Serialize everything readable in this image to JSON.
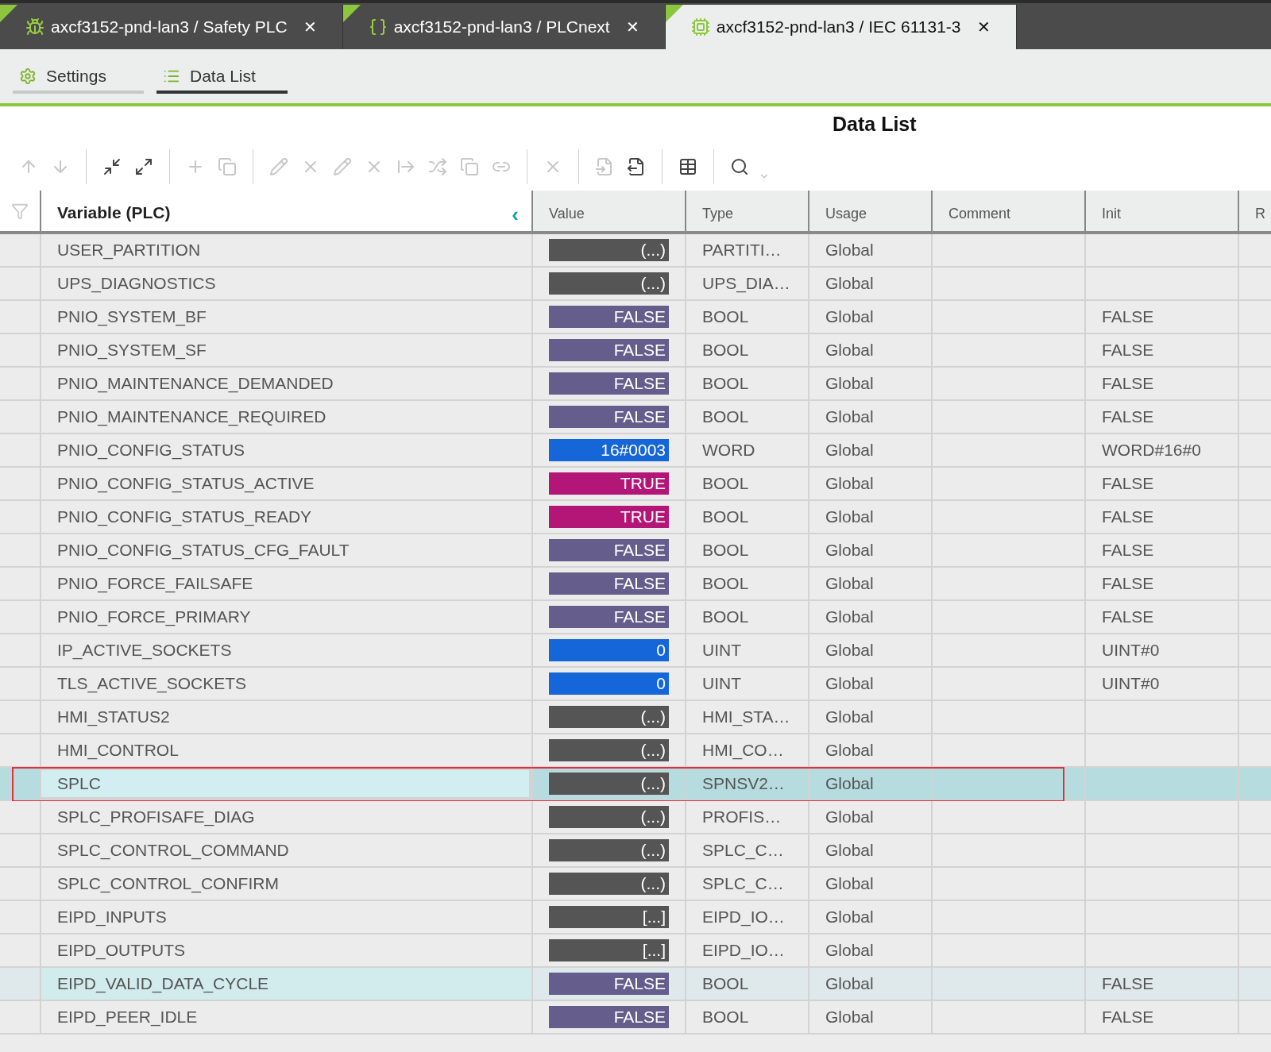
{
  "tabs": [
    {
      "label": "axcf3152-pnd-lan3 / Safety PLC",
      "selected": false,
      "kind": "safety"
    },
    {
      "label": "axcf3152-pnd-lan3 / PLCnext",
      "selected": false,
      "kind": "plcnext"
    },
    {
      "label": "axcf3152-pnd-lan3 / IEC 61131-3",
      "selected": true,
      "kind": "iec"
    }
  ],
  "close_glyph": "✕",
  "subtabs": [
    {
      "label": "Settings",
      "selected": false,
      "kind": "settings"
    },
    {
      "label": "Data List",
      "selected": true,
      "kind": "list"
    }
  ],
  "title": "Data List",
  "table": {
    "columns": [
      "Variable (PLC)",
      "Value",
      "Type",
      "Usage",
      "Comment",
      "Init",
      "R"
    ],
    "collapse_glyph": "‹",
    "rows": [
      {
        "variable": "USER_PARTITION",
        "value": "(...)",
        "kind": "complex",
        "type": "PARTITI…",
        "usage": "Global",
        "init": "",
        "selected": false,
        "hovered": false
      },
      {
        "variable": "UPS_DIAGNOSTICS",
        "value": "(...)",
        "kind": "complex",
        "type": "UPS_DIA…",
        "usage": "Global",
        "init": "",
        "selected": false,
        "hovered": false
      },
      {
        "variable": "PNIO_SYSTEM_BF",
        "value": "FALSE",
        "kind": "false",
        "type": "BOOL",
        "usage": "Global",
        "init": "FALSE",
        "selected": false,
        "hovered": false
      },
      {
        "variable": "PNIO_SYSTEM_SF",
        "value": "FALSE",
        "kind": "false",
        "type": "BOOL",
        "usage": "Global",
        "init": "FALSE",
        "selected": false,
        "hovered": false
      },
      {
        "variable": "PNIO_MAINTENANCE_DEMANDED",
        "value": "FALSE",
        "kind": "false",
        "type": "BOOL",
        "usage": "Global",
        "init": "FALSE",
        "selected": false,
        "hovered": false
      },
      {
        "variable": "PNIO_MAINTENANCE_REQUIRED",
        "value": "FALSE",
        "kind": "false",
        "type": "BOOL",
        "usage": "Global",
        "init": "FALSE",
        "selected": false,
        "hovered": false
      },
      {
        "variable": "PNIO_CONFIG_STATUS",
        "value": "16#0003",
        "kind": "numeric",
        "type": "WORD",
        "usage": "Global",
        "init": "WORD#16#0",
        "selected": false,
        "hovered": false
      },
      {
        "variable": "PNIO_CONFIG_STATUS_ACTIVE",
        "value": "TRUE",
        "kind": "true",
        "type": "BOOL",
        "usage": "Global",
        "init": "FALSE",
        "selected": false,
        "hovered": false
      },
      {
        "variable": "PNIO_CONFIG_STATUS_READY",
        "value": "TRUE",
        "kind": "true",
        "type": "BOOL",
        "usage": "Global",
        "init": "FALSE",
        "selected": false,
        "hovered": false
      },
      {
        "variable": "PNIO_CONFIG_STATUS_CFG_FAULT",
        "value": "FALSE",
        "kind": "false",
        "type": "BOOL",
        "usage": "Global",
        "init": "FALSE",
        "selected": false,
        "hovered": false
      },
      {
        "variable": "PNIO_FORCE_FAILSAFE",
        "value": "FALSE",
        "kind": "false",
        "type": "BOOL",
        "usage": "Global",
        "init": "FALSE",
        "selected": false,
        "hovered": false
      },
      {
        "variable": "PNIO_FORCE_PRIMARY",
        "value": "FALSE",
        "kind": "false",
        "type": "BOOL",
        "usage": "Global",
        "init": "FALSE",
        "selected": false,
        "hovered": false
      },
      {
        "variable": "IP_ACTIVE_SOCKETS",
        "value": "0",
        "kind": "numeric",
        "type": "UINT",
        "usage": "Global",
        "init": "UINT#0",
        "selected": false,
        "hovered": false
      },
      {
        "variable": "TLS_ACTIVE_SOCKETS",
        "value": "0",
        "kind": "numeric",
        "type": "UINT",
        "usage": "Global",
        "init": "UINT#0",
        "selected": false,
        "hovered": false
      },
      {
        "variable": "HMI_STATUS2",
        "value": "(...)",
        "kind": "complex",
        "type": "HMI_STA…",
        "usage": "Global",
        "init": "",
        "selected": false,
        "hovered": false
      },
      {
        "variable": "HMI_CONTROL",
        "value": "(...)",
        "kind": "complex",
        "type": "HMI_CO…",
        "usage": "Global",
        "init": "",
        "selected": false,
        "hovered": false
      },
      {
        "variable": "SPLC",
        "value": "(...)",
        "kind": "complex",
        "type": "SPNSV2…",
        "usage": "Global",
        "init": "",
        "selected": true,
        "hovered": false
      },
      {
        "variable": "SPLC_PROFISAFE_DIAG",
        "value": "(...)",
        "kind": "complex",
        "type": "PROFIS…",
        "usage": "Global",
        "init": "",
        "selected": false,
        "hovered": false
      },
      {
        "variable": "SPLC_CONTROL_COMMAND",
        "value": "(...)",
        "kind": "complex",
        "type": "SPLC_C…",
        "usage": "Global",
        "init": "",
        "selected": false,
        "hovered": false
      },
      {
        "variable": "SPLC_CONTROL_CONFIRM",
        "value": "(...)",
        "kind": "complex",
        "type": "SPLC_C…",
        "usage": "Global",
        "init": "",
        "selected": false,
        "hovered": false
      },
      {
        "variable": "EIPD_INPUTS",
        "value": "[...]",
        "kind": "complex",
        "type": "EIPD_IO…",
        "usage": "Global",
        "init": "",
        "selected": false,
        "hovered": false
      },
      {
        "variable": "EIPD_OUTPUTS",
        "value": "[...]",
        "kind": "complex",
        "type": "EIPD_IO…",
        "usage": "Global",
        "init": "",
        "selected": false,
        "hovered": false
      },
      {
        "variable": "EIPD_VALID_DATA_CYCLE",
        "value": "FALSE",
        "kind": "false",
        "type": "BOOL",
        "usage": "Global",
        "init": "FALSE",
        "selected": false,
        "hovered": true
      },
      {
        "variable": "EIPD_PEER_IDLE",
        "value": "FALSE",
        "kind": "false",
        "type": "BOOL",
        "usage": "Global",
        "init": "FALSE",
        "selected": false,
        "hovered": false
      }
    ]
  }
}
